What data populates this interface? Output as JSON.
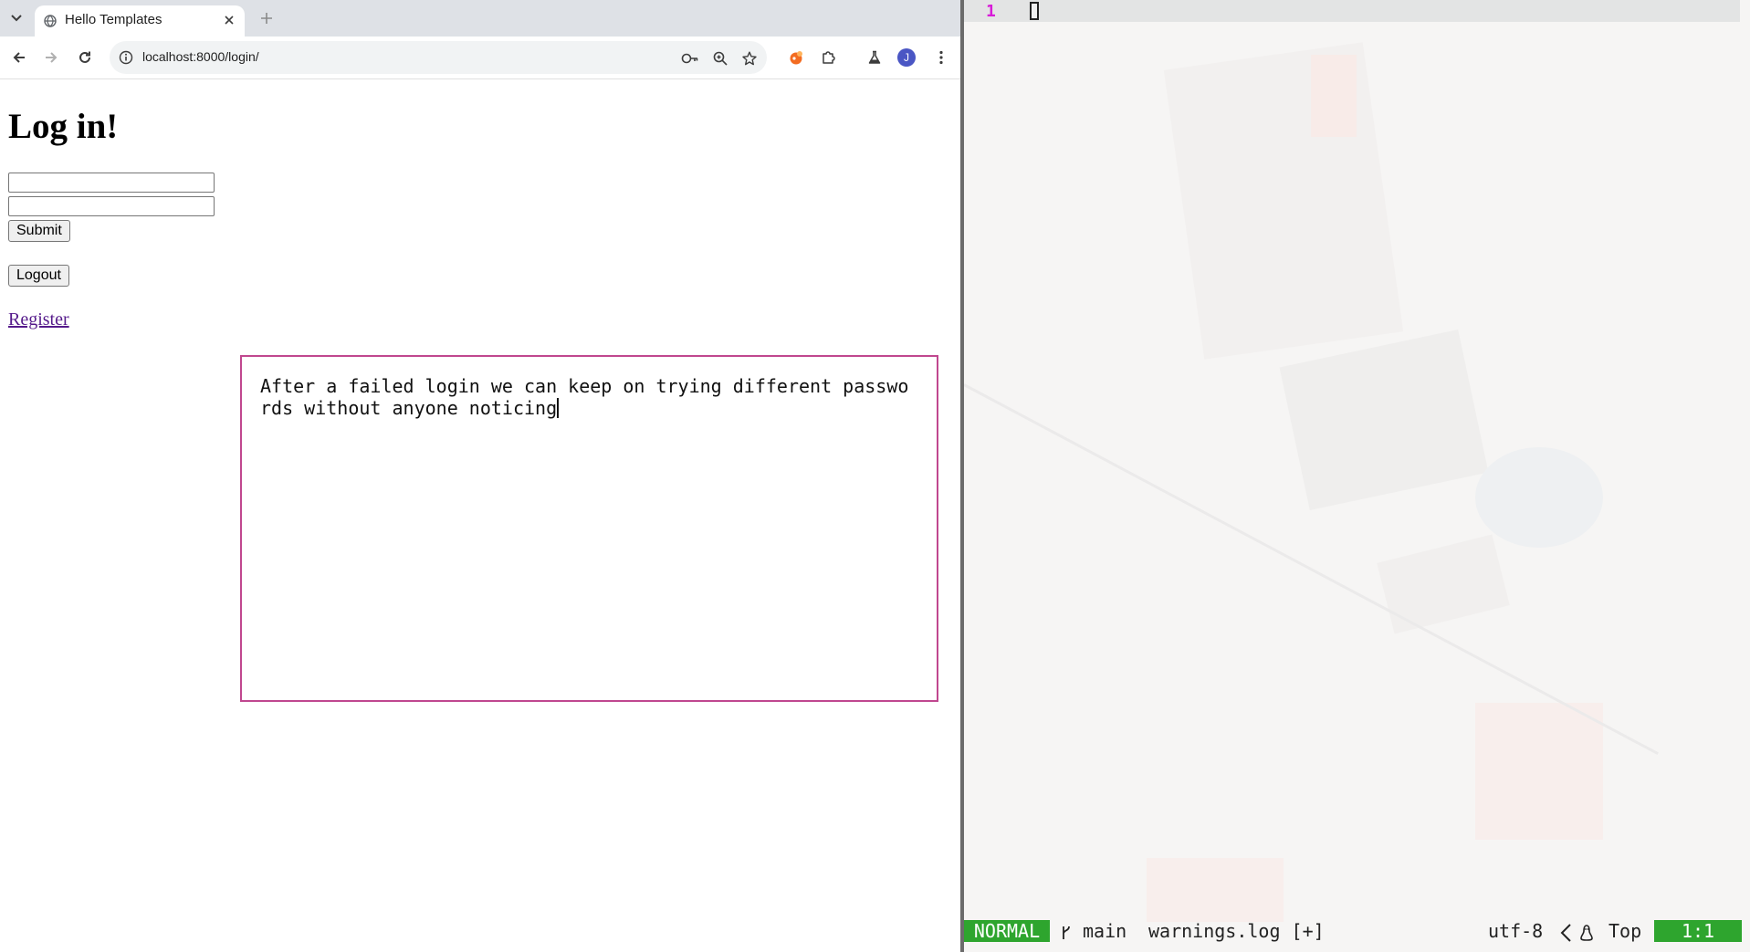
{
  "browser": {
    "tab": {
      "title": "Hello Templates"
    },
    "omnibox": {
      "url": "localhost:8000/login/"
    },
    "profile_initial": "J"
  },
  "page": {
    "heading": "Log in!",
    "username": {
      "value": "",
      "placeholder": ""
    },
    "password": {
      "value": "",
      "placeholder": ""
    },
    "submit_label": "Submit",
    "logout_label": "Logout",
    "register_label": "Register"
  },
  "note": {
    "text": "After a failed login we can keep on trying different passwords without anyone noticing",
    "border_color": "#c0478f"
  },
  "editor": {
    "line_number": "1",
    "status": {
      "mode": "NORMAL",
      "branch": "main",
      "file": "warnings.log [+]",
      "encoding": "utf-8",
      "position_label": "Top",
      "cursor": "1:1"
    },
    "colors": {
      "mode_bg": "#2ea52e",
      "line_number": "#d81bd8"
    }
  }
}
